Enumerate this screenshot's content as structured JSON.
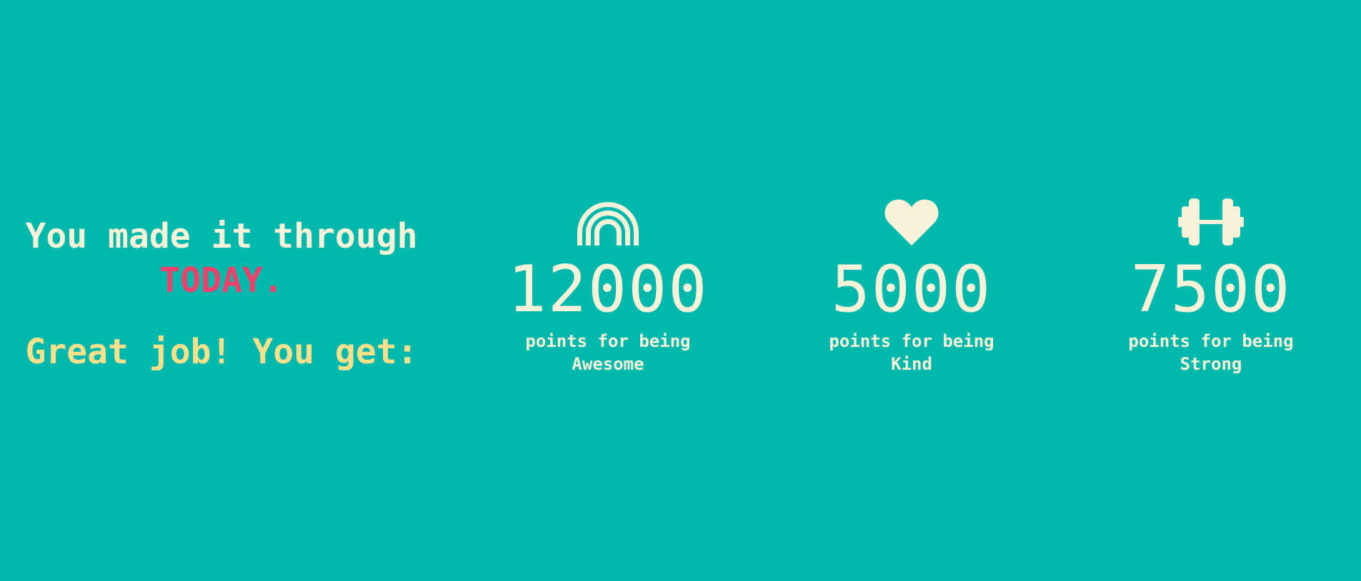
{
  "intro": {
    "line1": "You made it through",
    "today": "TODAY.",
    "cheer": "Great job! You get:"
  },
  "stats": [
    {
      "icon": "rainbow-icon",
      "value": "12000",
      "caption_line1": "points for being",
      "caption_line2": "Awesome"
    },
    {
      "icon": "heart-icon",
      "value": "5000",
      "caption_line1": "points for being",
      "caption_line2": "Kind"
    },
    {
      "icon": "dumbbell-icon",
      "value": "7500",
      "caption_line1": "points for being",
      "caption_line2": "Strong"
    }
  ],
  "colors": {
    "background": "#00b8ab",
    "text": "#f8f3d8",
    "accent": "#f2406a",
    "highlight": "#fbe08c"
  }
}
